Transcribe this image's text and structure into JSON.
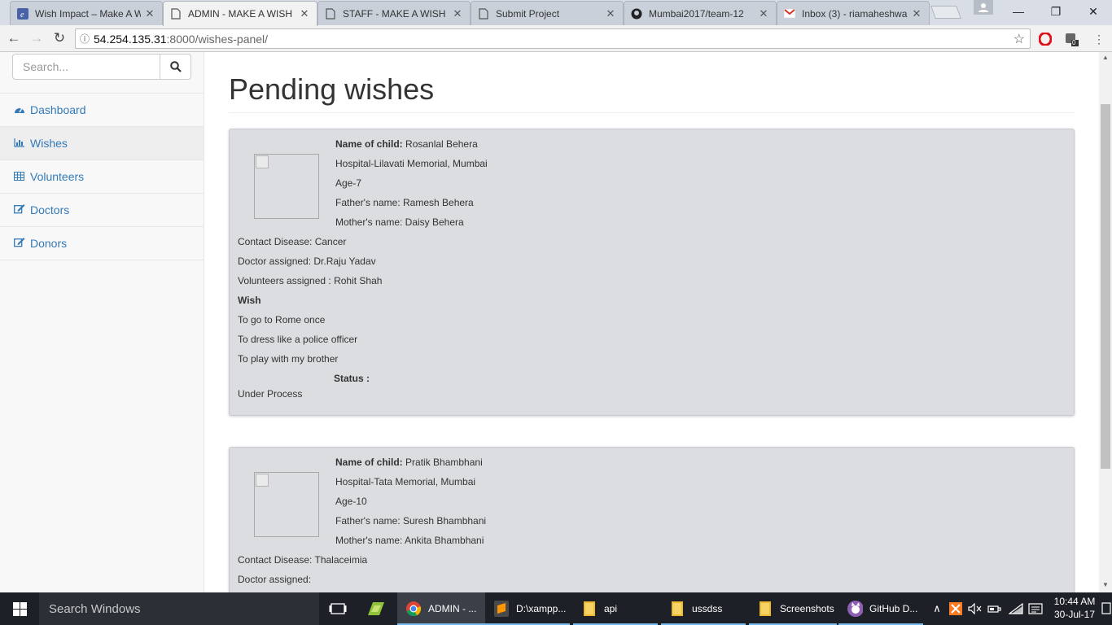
{
  "browser": {
    "tabs": [
      {
        "title": "Wish Impact – Make A W",
        "icon": "app-icon"
      },
      {
        "title": "ADMIN - MAKE A WISH",
        "icon": "page-icon"
      },
      {
        "title": "STAFF - MAKE A WISH I",
        "icon": "page-icon"
      },
      {
        "title": "Submit Project",
        "icon": "page-icon"
      },
      {
        "title": "Mumbai2017/team-12",
        "icon": "github-icon"
      },
      {
        "title": "Inbox (3) - riamaheshwa",
        "icon": "gmail-icon"
      }
    ],
    "url_host": "54.254.135.31",
    "url_rest": ":8000/wishes-panel/",
    "extension_badge": "0"
  },
  "sidebar": {
    "search_placeholder": "Search...",
    "items": [
      {
        "label": "Dashboard",
        "icon": "dashboard-icon"
      },
      {
        "label": "Wishes",
        "icon": "bar-chart-icon"
      },
      {
        "label": "Volunteers",
        "icon": "table-icon"
      },
      {
        "label": "Doctors",
        "icon": "edit-icon"
      },
      {
        "label": "Donors",
        "icon": "edit-icon"
      }
    ]
  },
  "main": {
    "title": "Pending wishes",
    "wishes": [
      {
        "name_label": "Name of child:",
        "name": "Rosanlal Behera",
        "hospital": "Hospital-Lilavati Memorial, Mumbai",
        "age": "Age-7",
        "father": "Father's name: Ramesh Behera",
        "mother": "Mother's name: Daisy Behera",
        "disease": "Contact Disease: Cancer",
        "doctor": "Doctor assigned: Dr.Raju Yadav",
        "volunteers": "Volunteers assigned : Rohit Shah",
        "wish_heading": "Wish",
        "wish_items": [
          "To go to Rome once",
          "To dress like a police officer",
          "To play with my brother"
        ],
        "status_label": "Status :",
        "status": "Under Process"
      },
      {
        "name_label": "Name of child:",
        "name": "Pratik Bhambhani",
        "hospital": "Hospital-Tata Memorial, Mumbai",
        "age": "Age-10",
        "father": "Father's name: Suresh Bhambhani",
        "mother": "Mother's name: Ankita Bhambhani",
        "disease": "Contact Disease: Thalaceimia",
        "doctor": "Doctor assigned:"
      }
    ]
  },
  "taskbar": {
    "search": "Search Windows",
    "items": [
      {
        "label": "ADMIN - ...",
        "icon": "chrome-icon"
      },
      {
        "label": "D:\\xampp...",
        "icon": "sublime-icon"
      },
      {
        "label": "api",
        "icon": "folder-icon"
      },
      {
        "label": "ussdss",
        "icon": "folder-icon"
      },
      {
        "label": "Screenshots",
        "icon": "folder-icon"
      },
      {
        "label": "GitHub D...",
        "icon": "github-desktop-icon"
      }
    ],
    "time": "10:44 AM",
    "date": "30-Jul-17"
  },
  "colors": {
    "link": "#337ab7",
    "card_bg": "#dcdde1",
    "taskbar": "#1d2026"
  }
}
